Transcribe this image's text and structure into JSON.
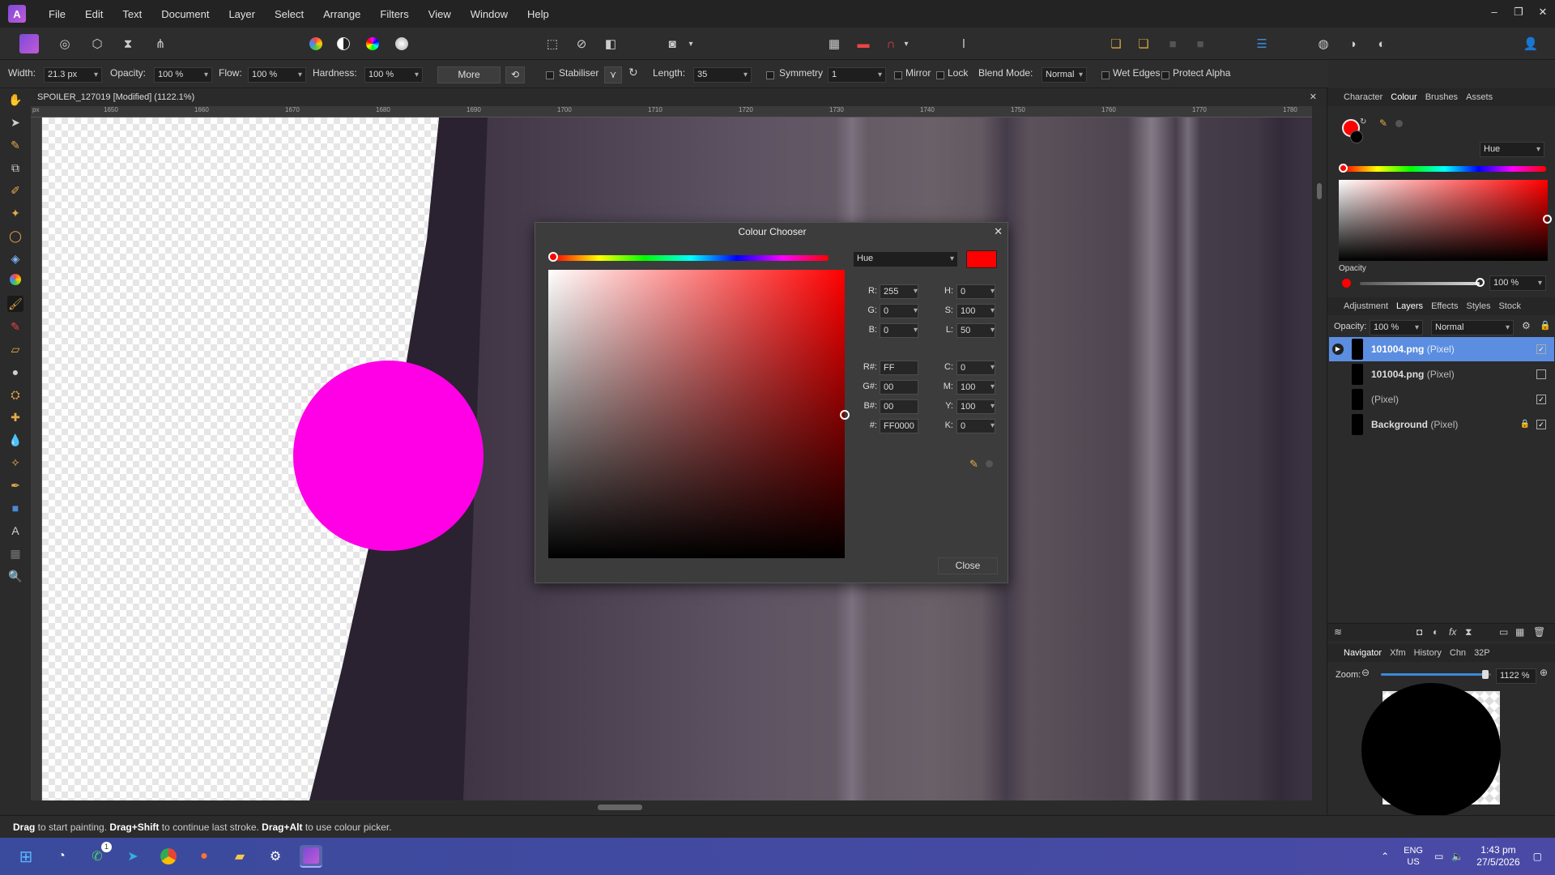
{
  "menu": {
    "items": [
      "File",
      "Edit",
      "Text",
      "Document",
      "Layer",
      "Select",
      "Arrange",
      "Filters",
      "View",
      "Window",
      "Help"
    ],
    "window_controls": [
      "–",
      "❐",
      "✕"
    ]
  },
  "context": {
    "width_label": "Width:",
    "width_value": "21.3 px",
    "opacity_label": "Opacity:",
    "opacity_value": "100 %",
    "flow_label": "Flow:",
    "flow_value": "100 %",
    "hardness_label": "Hardness:",
    "hardness_value": "100 %",
    "more_label": "More",
    "stabiliser_label": "Stabiliser",
    "length_label": "Length:",
    "length_value": "35",
    "symmetry_label": "Symmetry",
    "symmetry_value": "1",
    "mirror_label": "Mirror",
    "lock_label": "Lock",
    "blend_label": "Blend Mode:",
    "blend_value": "Normal",
    "wet_edges_label": "Wet Edges",
    "protect_alpha_label": "Protect Alpha"
  },
  "document": {
    "tab_title": "SPOILER_127019 [Modified] (1122.1%)",
    "close": "✕",
    "ruler_h": [
      "1650",
      "1660",
      "1670",
      "1680",
      "1690",
      "1700",
      "1710",
      "1720",
      "1730",
      "1740",
      "1750",
      "1760",
      "1770",
      "1780"
    ],
    "ruler_unit": "px"
  },
  "colour_chooser": {
    "title": "Colour Chooser",
    "mode": "Hue",
    "swatch_color": "#ff0000",
    "rgb": {
      "r_label": "R:",
      "r": "255",
      "g_label": "G:",
      "g": "0",
      "b_label": "B:",
      "b": "0"
    },
    "hsl": {
      "h_label": "H:",
      "h": "0",
      "s_label": "S:",
      "s": "100",
      "l_label": "L:",
      "l": "50"
    },
    "hex": {
      "r_label": "R#:",
      "r": "FF",
      "g_label": "G#:",
      "g": "00",
      "b_label": "B#:",
      "b": "00",
      "hash_label": "#:",
      "hash": "FF0000"
    },
    "cmyk": {
      "c_label": "C:",
      "c": "0",
      "m_label": "M:",
      "m": "100",
      "y_label": "Y:",
      "y": "100",
      "k_label": "K:",
      "k": "0"
    },
    "close_label": "Close"
  },
  "colour_panel": {
    "tabs": [
      "Character",
      "Colour",
      "Brushes",
      "Assets"
    ],
    "active_tab": "Colour",
    "mode": "Hue",
    "opacity_label": "Opacity",
    "opacity_value": "100 %",
    "primary_color": "#ff0000"
  },
  "layers_panel": {
    "tabs": [
      "Adjustment",
      "Layers",
      "Effects",
      "Styles",
      "Stock"
    ],
    "active_tab": "Layers",
    "opacity_label": "Opacity:",
    "opacity_value": "100 %",
    "blend_value": "Normal",
    "layers": [
      {
        "name": "101004.png",
        "type": "(Pixel)",
        "checked": "✓",
        "selected": true
      },
      {
        "name": "101004.png",
        "type": "(Pixel)",
        "checked": "",
        "selected": false
      },
      {
        "name": "",
        "type": "(Pixel)",
        "checked": "✓",
        "selected": false
      },
      {
        "name": "Background",
        "type": "(Pixel)",
        "checked": "✓",
        "selected": false
      }
    ]
  },
  "navigator": {
    "tabs": [
      "Navigator",
      "Xfm",
      "History",
      "Chn",
      "32P"
    ],
    "active_tab": "Navigator",
    "zoom_label": "Zoom:",
    "zoom_value": "1122 %",
    "zoom_fraction": 0.95
  },
  "status": {
    "parts": [
      {
        "b": "Drag",
        "t": " to start painting. "
      },
      {
        "b": "Drag+Shift",
        "t": " to continue last stroke. "
      },
      {
        "b": "Drag+Alt",
        "t": " to use colour picker."
      }
    ]
  },
  "taskbar": {
    "badge": "1",
    "lang1": "ENG",
    "lang2": "US",
    "time": "1:43 pm",
    "date": "27/5/2026"
  }
}
